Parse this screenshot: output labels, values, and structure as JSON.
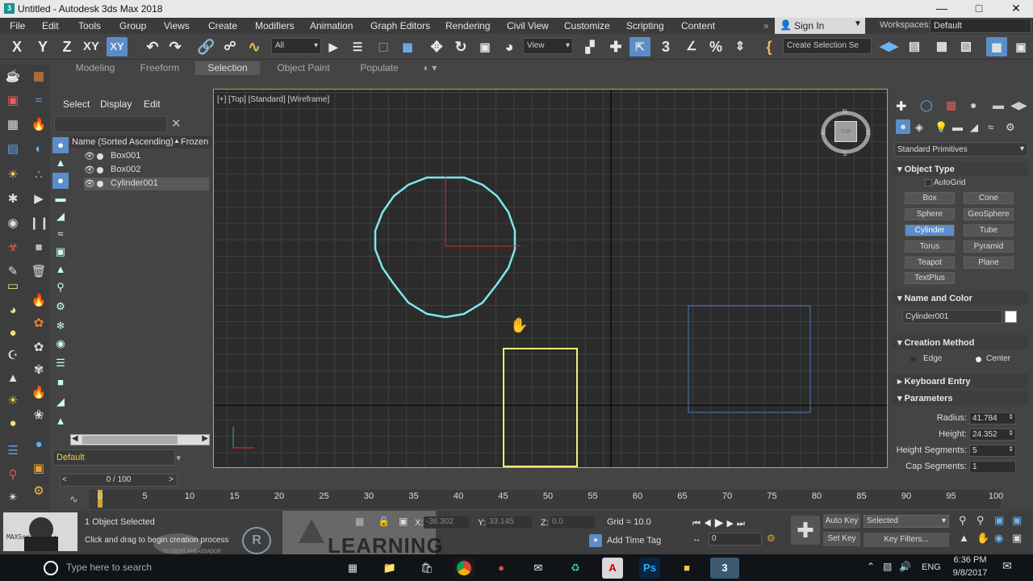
{
  "window": {
    "title": "Untitled - Autodesk 3ds Max 2018",
    "app_icon": "3"
  },
  "menu": [
    "File",
    "Edit",
    "Tools",
    "Group",
    "Views",
    "Create",
    "Modifiers",
    "Animation",
    "Graph Editors",
    "Rendering",
    "Civil View",
    "Customize",
    "Scripting",
    "Content"
  ],
  "signin": {
    "label": "Sign In"
  },
  "workspace": {
    "label": "Workspaces:",
    "value": "Default"
  },
  "toolbar": {
    "axes": [
      "X",
      "Y",
      "Z",
      "XY",
      "XY"
    ],
    "selection_filter": "All",
    "ref_coord": "View",
    "named_selection": "Create Selection Se"
  },
  "ribbon": {
    "tabs": [
      "Modeling",
      "Freeform",
      "Selection",
      "Object Paint",
      "Populate"
    ],
    "active": "Selection"
  },
  "explorer": {
    "tabs": [
      "Select",
      "Display",
      "Edit"
    ],
    "header": "Name (Sorted Ascending)",
    "frozen_col": "Frozen",
    "rows": [
      {
        "name": "Box001"
      },
      {
        "name": "Box002"
      },
      {
        "name": "Cylinder001"
      }
    ],
    "layer": "Default"
  },
  "viewport": {
    "label": "[+] [Top] [Standard] [Wireframe]",
    "viewcube_face": "TOP"
  },
  "command_panel": {
    "category": "Standard Primitives",
    "object_type": {
      "title": "Object Type",
      "autogrid": "AutoGrid",
      "buttons": [
        "Box",
        "Cone",
        "Sphere",
        "GeoSphere",
        "Cylinder",
        "Tube",
        "Torus",
        "Pyramid",
        "Teapot",
        "Plane",
        "TextPlus"
      ],
      "active": "Cylinder"
    },
    "name_color": {
      "title": "Name and Color",
      "name": "Cylinder001"
    },
    "creation_method": {
      "title": "Creation Method",
      "options": [
        "Edge",
        "Center"
      ],
      "selected": "Center"
    },
    "keyboard_entry": {
      "title": "Keyboard Entry"
    },
    "parameters": {
      "title": "Parameters",
      "radius_label": "Radius:",
      "radius": "41.784",
      "height_label": "Height:",
      "height": "24.352",
      "hseg_label": "Height Segments:",
      "hseg": "5",
      "cseg_label": "Cap Segments:",
      "cseg": "1"
    }
  },
  "timeline": {
    "slider": "0 / 100",
    "ticks": [
      "0",
      "5",
      "10",
      "15",
      "20",
      "25",
      "30",
      "35",
      "40",
      "45",
      "50",
      "55",
      "60",
      "65",
      "70",
      "75",
      "80",
      "85",
      "90",
      "95",
      "100"
    ]
  },
  "status": {
    "selected": "1 Object Selected",
    "prompt": "Click and drag to begin creation process",
    "x_label": "X:",
    "x": "-36.302",
    "y_label": "Y:",
    "y": "33.145",
    "z_label": "Z:",
    "z": "0.0",
    "grid": "Grid = 10.0",
    "add_time_tag": "Add Time Tag",
    "auto_key": "Auto Key",
    "set_key": "Set Key",
    "key_mode": "Selected",
    "key_filters": "Key Filters...",
    "frame": "0",
    "maxscript": "MAXScript Mi:",
    "watermark": "LEARNING",
    "ambassador": "STUDENT AMBASSADOR"
  },
  "taskbar": {
    "search": "Type here to search",
    "time": "6:36 PM",
    "date": "9/8/2017",
    "lang": "ENG"
  }
}
